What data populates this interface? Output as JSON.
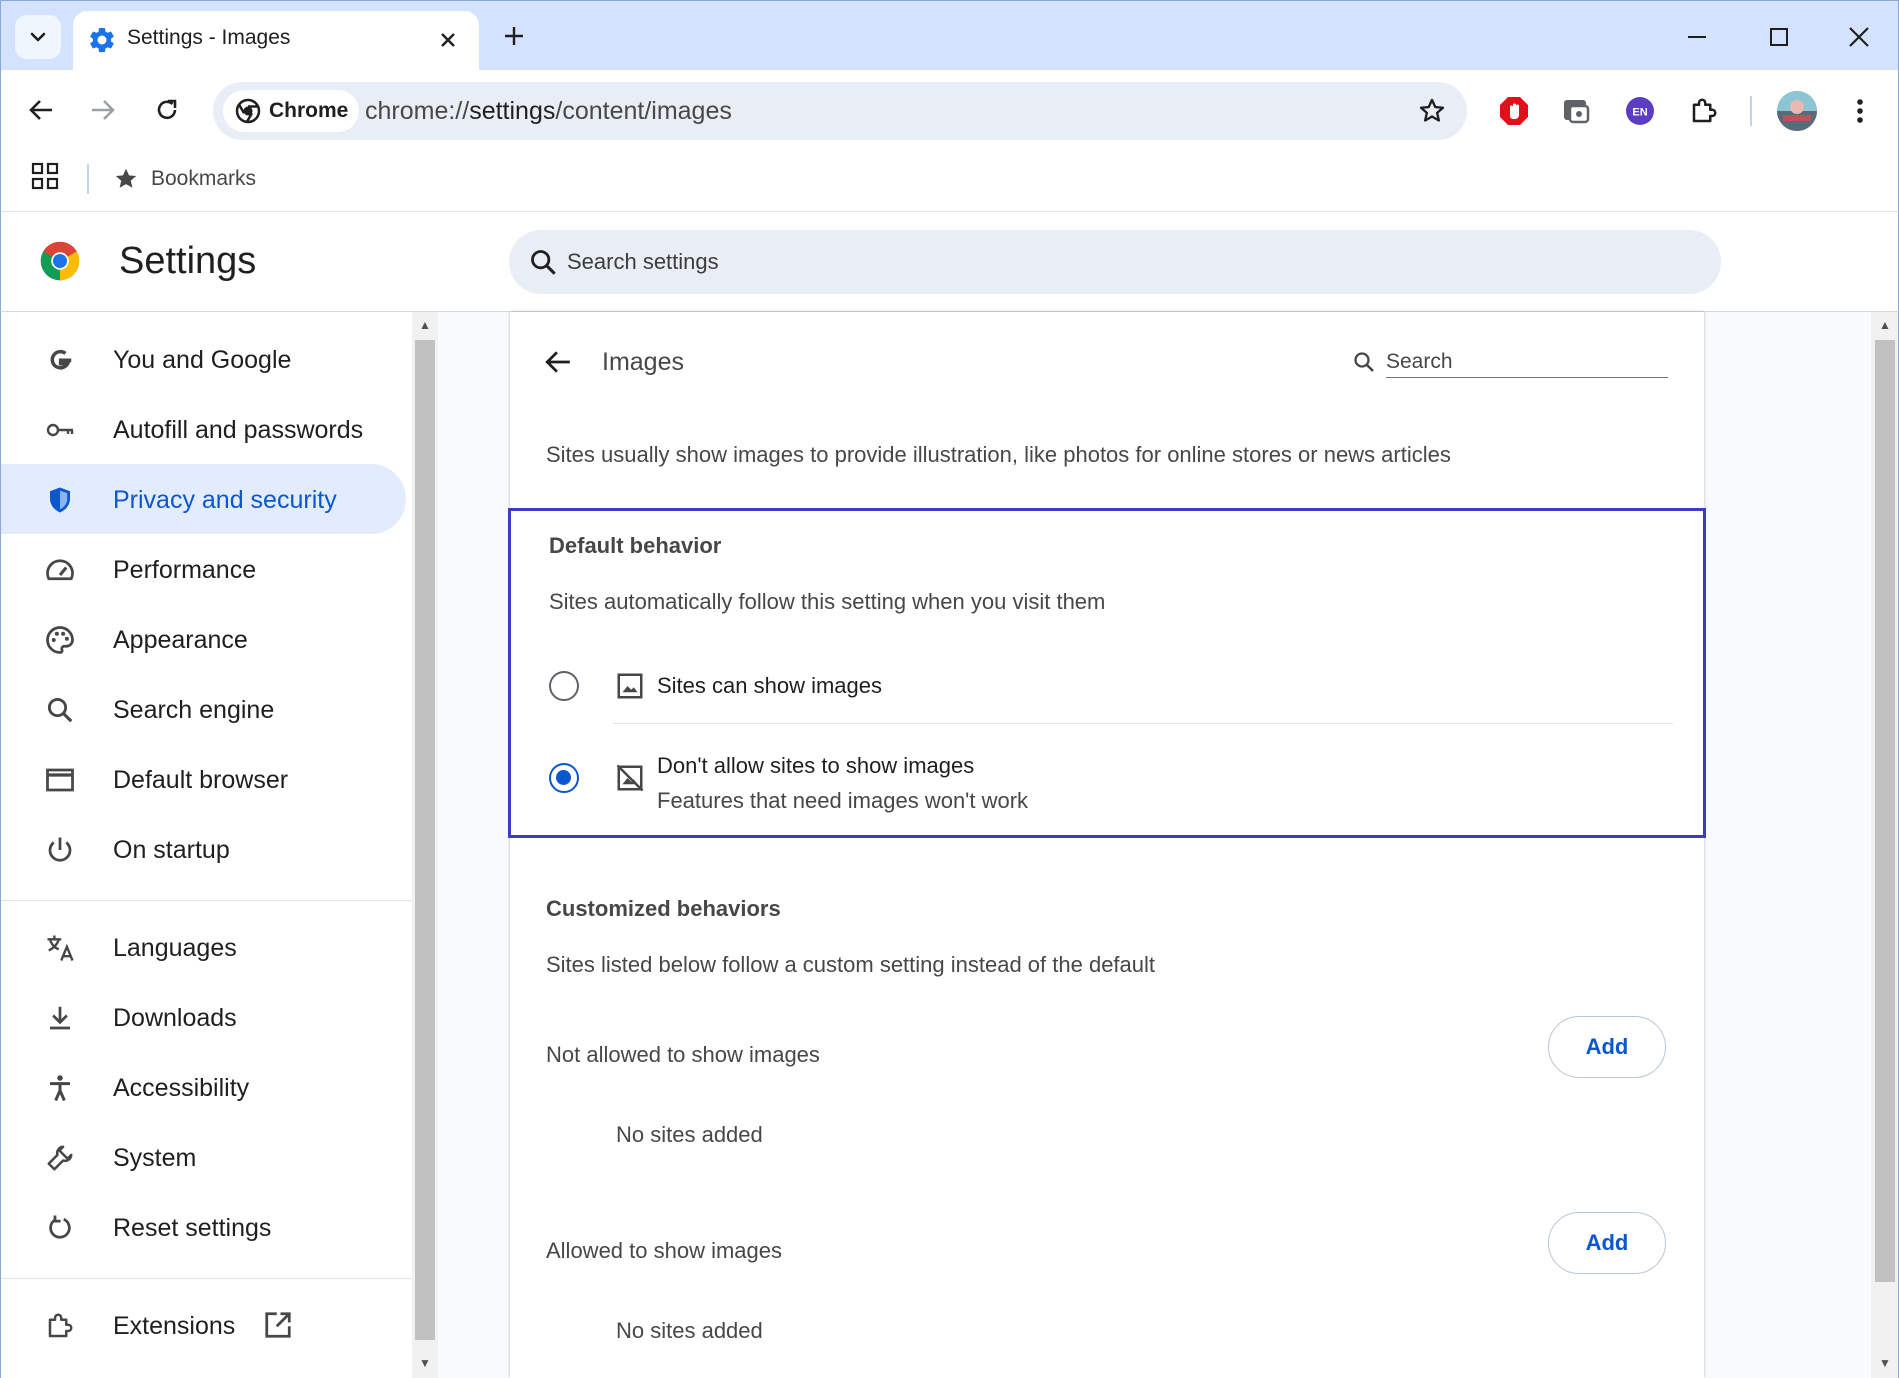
{
  "browser": {
    "tab": {
      "title": "Settings - Images"
    },
    "omnibox": {
      "chip_label": "Chrome",
      "url_scheme": "chrome://",
      "url_host": "settings",
      "url_path": "/content/images"
    },
    "extensions": [
      "adblock-icon",
      "reader-extension-icon",
      "en-translate-icon",
      "puzzle-icon"
    ],
    "bookmarks_bar": {
      "item_label": "Bookmarks"
    },
    "ext_badge_text": "EN"
  },
  "settings": {
    "title": "Settings",
    "search_placeholder": "Search settings"
  },
  "sidebar": {
    "items": [
      {
        "label": "You and Google",
        "icon": "google-g-icon"
      },
      {
        "label": "Autofill and passwords",
        "icon": "key-icon"
      },
      {
        "label": "Privacy and security",
        "icon": "shield-icon",
        "active": true
      },
      {
        "label": "Performance",
        "icon": "speedometer-icon"
      },
      {
        "label": "Appearance",
        "icon": "palette-icon"
      },
      {
        "label": "Search engine",
        "icon": "search-icon"
      },
      {
        "label": "Default browser",
        "icon": "browser-window-icon"
      },
      {
        "label": "On startup",
        "icon": "power-icon"
      },
      {
        "label": "Languages",
        "icon": "translate-icon"
      },
      {
        "label": "Downloads",
        "icon": "download-icon"
      },
      {
        "label": "Accessibility",
        "icon": "accessibility-icon"
      },
      {
        "label": "System",
        "icon": "wrench-icon"
      },
      {
        "label": "Reset settings",
        "icon": "reset-icon"
      },
      {
        "label": "Extensions",
        "icon": "puzzle-icon"
      }
    ]
  },
  "page": {
    "title": "Images",
    "search_placeholder": "Search",
    "description": "Sites usually show images to provide illustration, like photos for online stores or news articles",
    "default_behavior": {
      "title": "Default behavior",
      "subtitle": "Sites automatically follow this setting when you visit them",
      "options": [
        {
          "label": "Sites can show images",
          "sublabel": "",
          "checked": false
        },
        {
          "label": "Don't allow sites to show images",
          "sublabel": "Features that need images won't work",
          "checked": true
        }
      ]
    },
    "customized": {
      "title": "Customized behaviors",
      "subtitle": "Sites listed below follow a custom setting instead of the default",
      "lists": [
        {
          "label": "Not allowed to show images",
          "add_label": "Add",
          "empty_text": "No sites added"
        },
        {
          "label": "Allowed to show images",
          "add_label": "Add",
          "empty_text": "No sites added"
        }
      ]
    }
  },
  "colors": {
    "accent": "#0b57d0",
    "highlight_border": "#3b3fbf",
    "active_nav_bg": "#e3ecfc",
    "tabstrip_bg": "#d3e3fd"
  }
}
